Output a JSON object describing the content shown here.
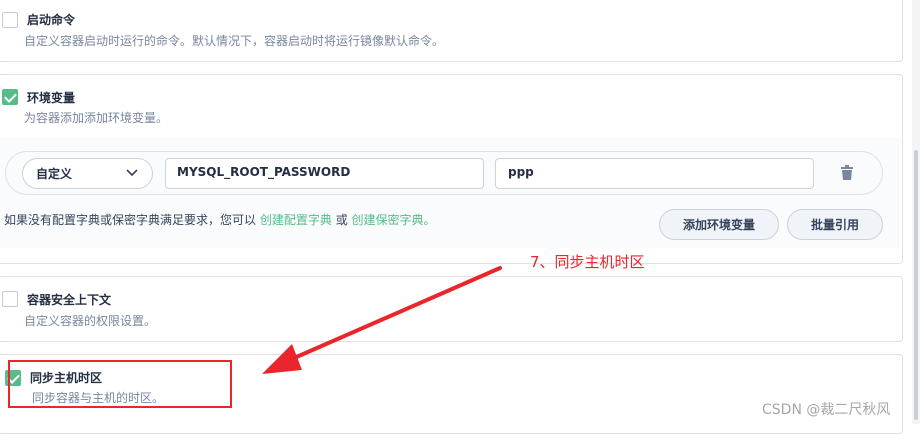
{
  "startup_command": {
    "title": "启动命令",
    "description": "自定义容器启动时运行的命令。默认情况下，容器启动时将运行镜像默认命令。",
    "checked": false
  },
  "env_vars": {
    "title": "环境变量",
    "description": "为容器添加添加环境变量。",
    "checked": true,
    "row": {
      "type_value": "自定义",
      "key_value": "MYSQL_ROOT_PASSWORD",
      "value_value": "ppp"
    },
    "hint_prefix": "如果没有配置字典或保密字典满足要求，您可以",
    "link_config": "创建配置字典",
    "hint_or": "或",
    "link_secret": "创建保密字典。",
    "add_button": "添加环境变量",
    "bulk_button": "批量引用"
  },
  "security_context": {
    "title": "容器安全上下文",
    "description": "自定义容器的权限设置。",
    "checked": false
  },
  "sync_timezone": {
    "title": "同步主机时区",
    "description": "同步容器与主机的时区。",
    "checked": true
  },
  "annotation": {
    "text": "7、同步主机时区",
    "color": "#e8262b"
  },
  "watermark": "CSDN @裁二尺秋风",
  "colors": {
    "accent": "#55bc8a",
    "annotation_red": "#e8262b"
  }
}
